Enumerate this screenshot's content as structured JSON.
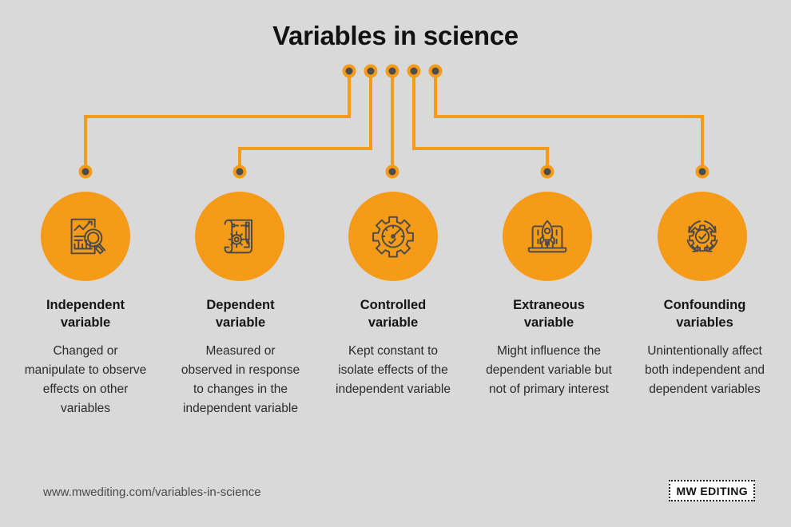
{
  "title": "Variables in science",
  "colors": {
    "background": "#d9d9d9",
    "accent_orange": "#f59b18",
    "node_center": "#4d4d4d",
    "icon_stroke": "#4a4a4a",
    "title_text": "#121212",
    "body_text": "#2b2b2b",
    "url_text": "#4a4a4a"
  },
  "nodes": [
    {
      "id": "independent",
      "icon": "document-chart-magnifier-icon",
      "heading": "Independent\nvariable",
      "heading_line1": "Independent",
      "heading_line2": "variable",
      "description": "Changed or manipulate to observe effects on other variables"
    },
    {
      "id": "dependent",
      "icon": "blueprint-gear-pencil-icon",
      "heading_line1": "Dependent",
      "heading_line2": "variable",
      "description": "Measured or observed in response to changes in the independent variable"
    },
    {
      "id": "controlled",
      "icon": "gear-gauge-icon",
      "heading_line1": "Controlled",
      "heading_line2": "variable",
      "description": "Kept constant to isolate effects of the independent variable"
    },
    {
      "id": "extraneous",
      "icon": "rocket-laptop-icon",
      "heading_line1": "Extraneous",
      "heading_line2": "variable",
      "description": "Might influence the dependent variable but not of primary interest"
    },
    {
      "id": "confounding",
      "icon": "gear-check-cycle-icon",
      "heading_line1": "Confounding",
      "heading_line2": "variables",
      "description": "Unintentionally affect both independent and dependent variables"
    }
  ],
  "footer": {
    "url": "www.mwediting.com/variables-in-science",
    "logo_text": "MW EDITING"
  }
}
